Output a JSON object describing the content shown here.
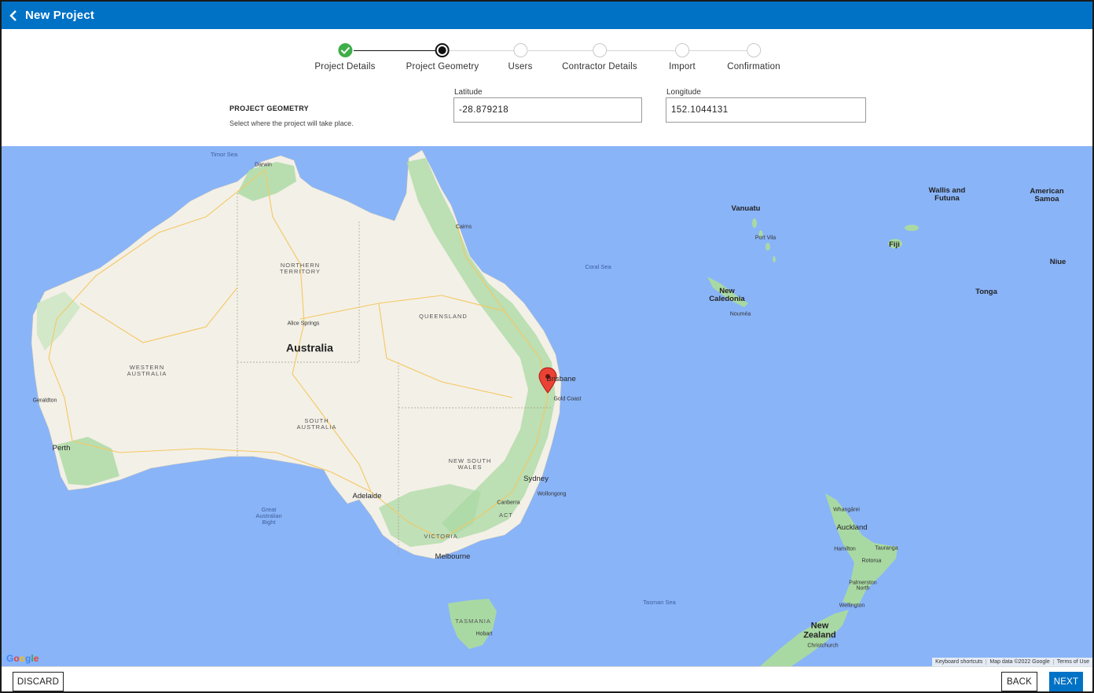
{
  "header": {
    "title": "New Project"
  },
  "stepper": {
    "steps": [
      {
        "label": "Project Details",
        "state": "done"
      },
      {
        "label": "Project Geometry",
        "state": "active"
      },
      {
        "label": "Users",
        "state": "pending"
      },
      {
        "label": "Contractor Details",
        "state": "pending"
      },
      {
        "label": "Import",
        "state": "pending"
      },
      {
        "label": "Confirmation",
        "state": "pending"
      }
    ]
  },
  "geometry": {
    "title": "PROJECT GEOMETRY",
    "subtitle": "Select where the project will take place.",
    "latitude_label": "Latitude",
    "latitude_value": "-28.879218",
    "longitude_label": "Longitude",
    "longitude_value": "152.1044131"
  },
  "map": {
    "labels": {
      "timor_sea": "Timor Sea",
      "darwin": "Darwin",
      "cairns": "Cairns",
      "northern_territory": "NORTHERN TERRITORY",
      "coral_sea": "Coral Sea",
      "alice_springs": "Alice Springs",
      "queensland": "QUEENSLAND",
      "australia": "Australia",
      "western_australia": "WESTERN AUSTRALIA",
      "geraldton": "Geraldton",
      "brisbane": "Brisbane",
      "gold_coast": "Gold Coast",
      "south_australia": "SOUTH AUSTRALIA",
      "perth": "Perth",
      "new_south_wales": "NEW SOUTH WALES",
      "sydney": "Sydney",
      "wollongong": "Wollongong",
      "adelaide": "Adelaide",
      "canberra": "Canberra",
      "act": "ACT",
      "great_australian_bight": "Great Australian Bight",
      "victoria": "VICTORIA",
      "melbourne": "Melbourne",
      "tasmania": "TASMANIA",
      "hobart": "Hobart",
      "tasman_sea": "Tasman Sea",
      "vanuatu": "Vanuatu",
      "port_vila": "Port Vila",
      "new_caledonia": "New Caledonia",
      "noumea": "Nouméa",
      "fiji": "Fiji",
      "wallis_futuna": "Wallis and Futuna",
      "american_samoa": "American Samoa",
      "niue": "Niue",
      "tonga": "Tonga",
      "whangarei": "Whangārei",
      "auckland": "Auckland",
      "hamilton": "Hamilton",
      "tauranga": "Tauranga",
      "rotorua": "Rotorua",
      "palmerston_north": "Palmerston North",
      "wellington": "Wellington",
      "new_zealand": "New Zealand",
      "christchurch": "Christchurch"
    },
    "google_logo": "Google",
    "footer": {
      "shortcuts": "Keyboard shortcuts",
      "map_data": "Map data ©2022 Google",
      "terms": "Terms of Use"
    }
  },
  "footer": {
    "discard_label": "DISCARD",
    "back_label": "BACK",
    "next_label": "NEXT"
  },
  "colors": {
    "brand": "#0072c6",
    "done": "#3fae49",
    "water": "#89b4f8",
    "land": "#f3f0e7",
    "vegetation": "#a9d9a3",
    "marker": "#ea4335"
  }
}
